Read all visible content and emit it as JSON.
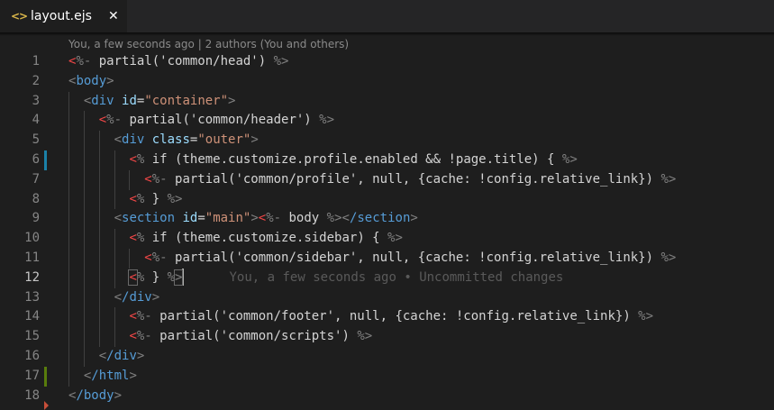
{
  "tab": {
    "icon": "<>",
    "icon_name": "code-file-icon",
    "label": "layout.ejs",
    "close": "✕"
  },
  "blame_header": "You, a few seconds ago | 2 authors (You and others)",
  "inline_blame": "You, a few seconds ago • Uncommitted changes",
  "active_line": 12,
  "highlight_text": "&& !page.title)",
  "colors": {
    "background": "#1e1e1e",
    "tag": "#569cd6",
    "template_delimiter": "#f44747",
    "attribute": "#9cdcfe",
    "string": "#ce9178",
    "modified_gutter": "#1b81a8",
    "added_gutter": "#587c0c",
    "deleted_gutter": "#c74e39",
    "highlight_box": "#e23d6d"
  },
  "lines": [
    {
      "n": "1",
      "text": "<%- partial('common/head') %>"
    },
    {
      "n": "2",
      "text": "<body>"
    },
    {
      "n": "3",
      "text": "<div id=\"container\">"
    },
    {
      "n": "4",
      "text": "<%- partial('common/header') %>"
    },
    {
      "n": "5",
      "text": "<div class=\"outer\">"
    },
    {
      "n": "6",
      "text": "<% if (theme.customize.profile.enabled && !page.title) { %>"
    },
    {
      "n": "7",
      "text": "<%- partial('common/profile', null, {cache: !config.relative_link}) %>"
    },
    {
      "n": "8",
      "text": "<% } %>"
    },
    {
      "n": "9",
      "text": "<section id=\"main\"><%- body %></section>"
    },
    {
      "n": "10",
      "text": "<% if (theme.customize.sidebar) { %>"
    },
    {
      "n": "11",
      "text": "<%- partial('common/sidebar', null, {cache: !config.relative_link}) %>"
    },
    {
      "n": "12",
      "text": "<% } %>"
    },
    {
      "n": "13",
      "text": "</div>"
    },
    {
      "n": "14",
      "text": "<%- partial('common/footer', null, {cache: !config.relative_link}) %>"
    },
    {
      "n": "15",
      "text": "<%- partial('common/scripts') %>"
    },
    {
      "n": "16",
      "text": "</div>"
    },
    {
      "n": "17",
      "text": "</html>"
    },
    {
      "n": "18",
      "text": "</body>"
    }
  ]
}
